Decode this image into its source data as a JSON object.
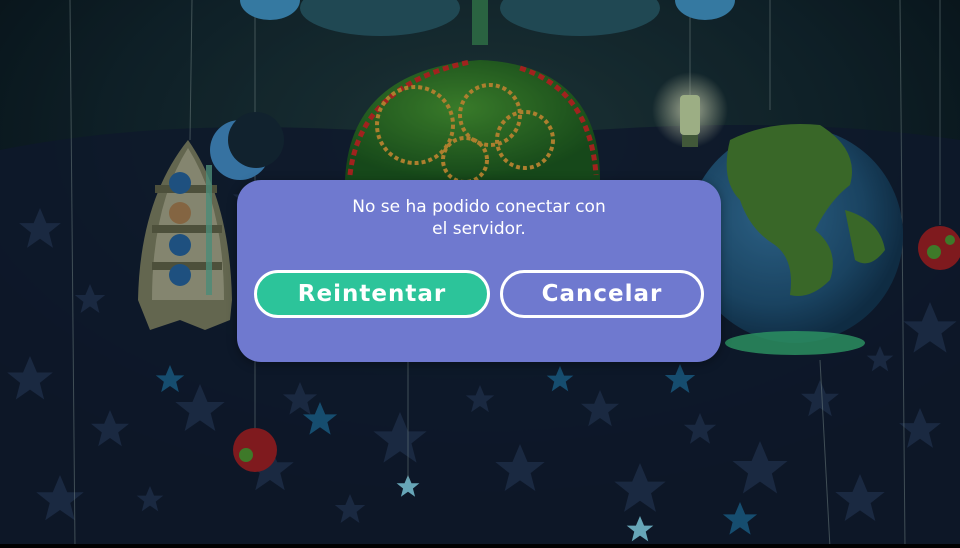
{
  "dialog": {
    "message": "No se ha podido conectar con\nel servidor.",
    "retry_label": "Reintentar",
    "cancel_label": "Cancelar"
  },
  "colors": {
    "dialog_bg": "#6f79cf",
    "retry_bg": "#2cc49a",
    "button_border": "#ffffff",
    "text": "#ffffff"
  },
  "background": {
    "objects": [
      "rocket-ornament",
      "green-ball-ornament",
      "earth-globe-ornament",
      "crescent-moon-ornament",
      "lantern-ornament",
      "red-bauble-ornament",
      "cloud-decoration",
      "star-decoration"
    ]
  }
}
